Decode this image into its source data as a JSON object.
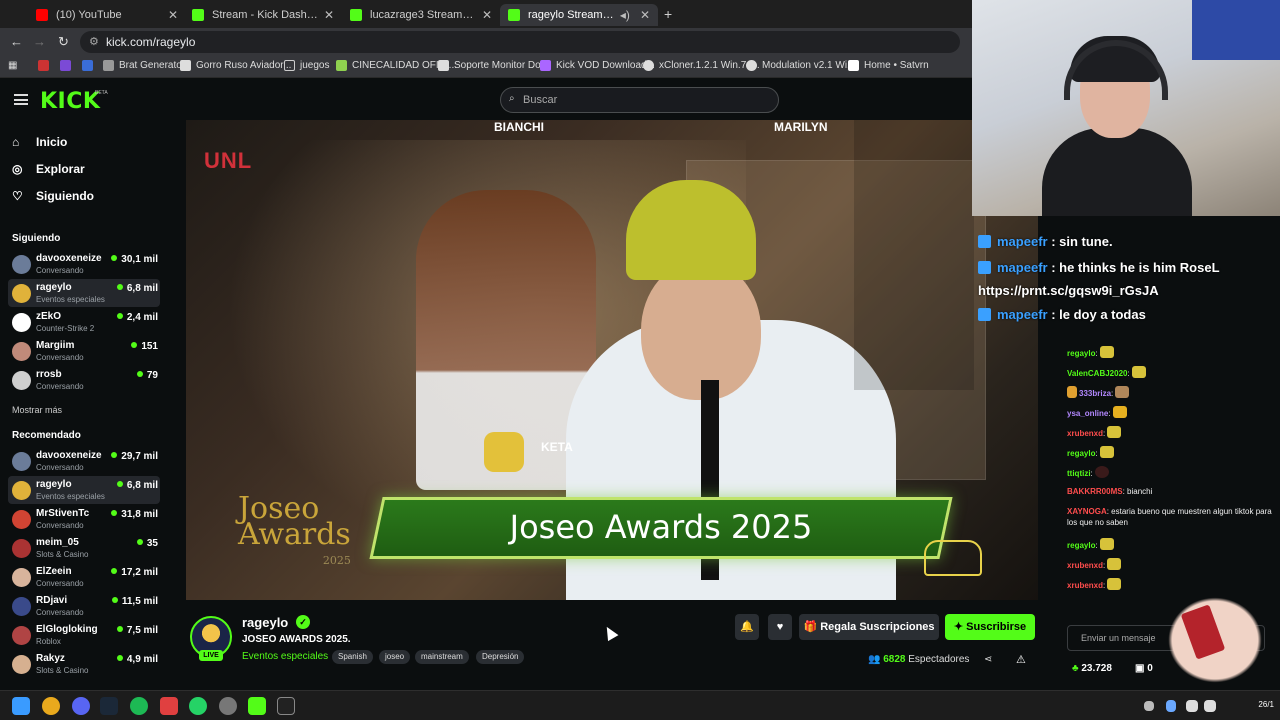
{
  "browser": {
    "tabs": [
      {
        "title": "(10) YouTube",
        "color": "#ff0000"
      },
      {
        "title": "Stream - Kick Dashboard",
        "color": "#53fc18"
      },
      {
        "title": "lucazrage3 Stream - Watch Live",
        "color": "#53fc18"
      },
      {
        "title": "rageylo Stream - Watch Live",
        "color": "#53fc18"
      }
    ],
    "url": "kick.com/rageylo",
    "bookmarks": [
      "Brat Generator",
      "Gorro Ruso Aviador...",
      "juegos",
      "CINECALIDAD OFICI...",
      "Soporte Monitor Do...",
      "Kick VOD Download...",
      "xCloner.1.2.1 Win.7z...",
      "Modulation v2.1 Wi...",
      "Home • Satvrn"
    ]
  },
  "header": {
    "logo": "KICK",
    "logo_beta": "BETA",
    "search_placeholder": "Buscar"
  },
  "nav": {
    "inicio": "Inicio",
    "explorar": "Explorar",
    "siguiendo": "Siguiendo"
  },
  "following": {
    "heading": "Siguiendo",
    "show_more": "Mostrar más",
    "channels": [
      {
        "name": "davooxeneize",
        "category": "Conversando",
        "viewers": "30,1 mil",
        "color": "#6b7c99"
      },
      {
        "name": "rageylo",
        "category": "Eventos especiales",
        "viewers": "6,8 mil",
        "color": "#e0b23a"
      },
      {
        "name": "zEkO",
        "category": "Counter-Strike 2",
        "viewers": "2,4 mil",
        "color": "#ffffff"
      },
      {
        "name": "Margiim",
        "category": "Conversando",
        "viewers": "151",
        "color": "#c08a7a"
      },
      {
        "name": "rrosb",
        "category": "Conversando",
        "viewers": "79",
        "color": "#cfcfcf"
      }
    ]
  },
  "recommended": {
    "heading": "Recomendado",
    "channels": [
      {
        "name": "davooxeneize",
        "category": "Conversando",
        "viewers": "29,7 mil",
        "color": "#6b7c99"
      },
      {
        "name": "rageylo",
        "category": "Eventos especiales",
        "viewers": "6,8 mil",
        "color": "#e0b23a"
      },
      {
        "name": "MrStivenTc",
        "category": "Conversando",
        "viewers": "31,8 mil",
        "color": "#d04433"
      },
      {
        "name": "meim_05",
        "category": "Slots & Casino",
        "viewers": "35",
        "color": "#a33"
      },
      {
        "name": "ElZeein",
        "category": "Conversando",
        "viewers": "17,2 mil",
        "color": "#d8b49c"
      },
      {
        "name": "RDjavi",
        "category": "Conversando",
        "viewers": "11,5 mil",
        "color": "#3a4a8a"
      },
      {
        "name": "ElGlogloking",
        "category": "Roblox",
        "viewers": "7,5 mil",
        "color": "#b04444"
      },
      {
        "name": "Rakyz",
        "category": "Slots & Casino",
        "viewers": "4,9 mil",
        "color": "#d6b090"
      }
    ]
  },
  "video": {
    "banner": "Joseo Awards 2025",
    "logo_line1": "Joseo",
    "logo_line2": "Awards",
    "logo_year": "2025",
    "top_left": "BIANCHI",
    "top_right": "MARILYN",
    "neta": "KETA",
    "unl": "UNL"
  },
  "stream": {
    "channel": "rageylo",
    "title": "JOSEO AWARDS 2025.",
    "category": "Eventos especiales",
    "tags": [
      "Spanish",
      "joseo",
      "mainstream",
      "Depresión"
    ],
    "live": "LIVE",
    "gift_label": "Regala Suscripciones",
    "subscribe_label": "Suscribirse",
    "viewers": "6828",
    "viewers_label": "Espectadores"
  },
  "overlay_chat": [
    {
      "user": "mapeefr",
      "text": "sin tune."
    },
    {
      "user": "mapeefr",
      "text": "he thinks he is him RoseL"
    },
    {
      "user": "",
      "text": "https://prnt.sc/gqsw9i_rGsJA"
    },
    {
      "user": "mapeefr",
      "text": "le doy a todas"
    }
  ],
  "chat": {
    "messages": [
      {
        "user": "regaylo",
        "text": "",
        "color": "#53fc18"
      },
      {
        "user": "ValenCABJ2020",
        "text": "",
        "color": "#53fc18"
      },
      {
        "user": "333briza",
        "text": "",
        "color": "#b388ff"
      },
      {
        "user": "ysa_online",
        "text": "",
        "color": "#b388ff"
      },
      {
        "user": "xrubenxd",
        "text": "",
        "color": "#ff4d4d"
      },
      {
        "user": "regaylo",
        "text": "",
        "color": "#53fc18"
      },
      {
        "user": "ttiqtizi",
        "text": "",
        "color": "#53fc18"
      },
      {
        "user": "BAKKRR00MS",
        "text": "bianchi",
        "color": "#ff4d4d"
      },
      {
        "user": "XAYNOGA",
        "text": "estaria bueno que muestren algun tiktok para los que no saben",
        "color": "#ff4d4d"
      },
      {
        "user": "regaylo",
        "text": "",
        "color": "#53fc18"
      },
      {
        "user": "xrubenxd",
        "text": "",
        "color": "#ff4d4d"
      },
      {
        "user": "xrubenxd",
        "text": "",
        "color": "#ff4d4d"
      }
    ],
    "input_placeholder": "Enviar un mensaje",
    "points": "23.728",
    "gifts": "0"
  },
  "taskbar": {
    "clock": "26/1"
  }
}
